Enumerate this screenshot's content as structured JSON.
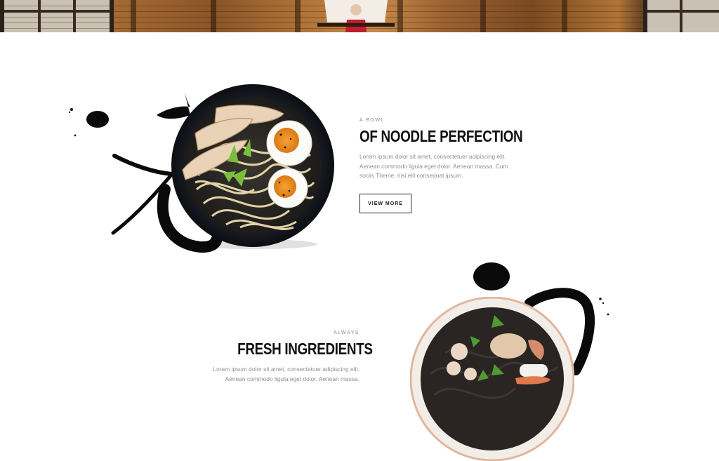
{
  "banner": {
    "image": "restaurant-interior-photo"
  },
  "section1": {
    "eyebrow": "A BOWL",
    "heading": "OF NOODLE PERFECTION",
    "body": "Lorem ipsum dolor sit amet, consectetuer adipiscing elit. Aenean commodo ligula eget dolor. Aenean massa. Cum sociis Theme, nisi elit consequat ipsum.",
    "button_label": "VIEW MORE",
    "image": "ramen-bowl-photo",
    "decoration": "ink-brush-calligraphy"
  },
  "section2": {
    "eyebrow": "ALWAYS",
    "heading": "FRESH INGREDIENTS",
    "body": "Lorem ipsum dolor sit amet, consectetuer adipiscing elit. Aenean commodo ligula eget dolor. Aenean massa.",
    "image": "seafood-noodle-bowl-photo",
    "decoration": "ink-brush-calligraphy"
  },
  "colors": {
    "heading": "#111111",
    "body": "#8f8f8f",
    "button_border": "#222222",
    "background": "#ffffff"
  }
}
